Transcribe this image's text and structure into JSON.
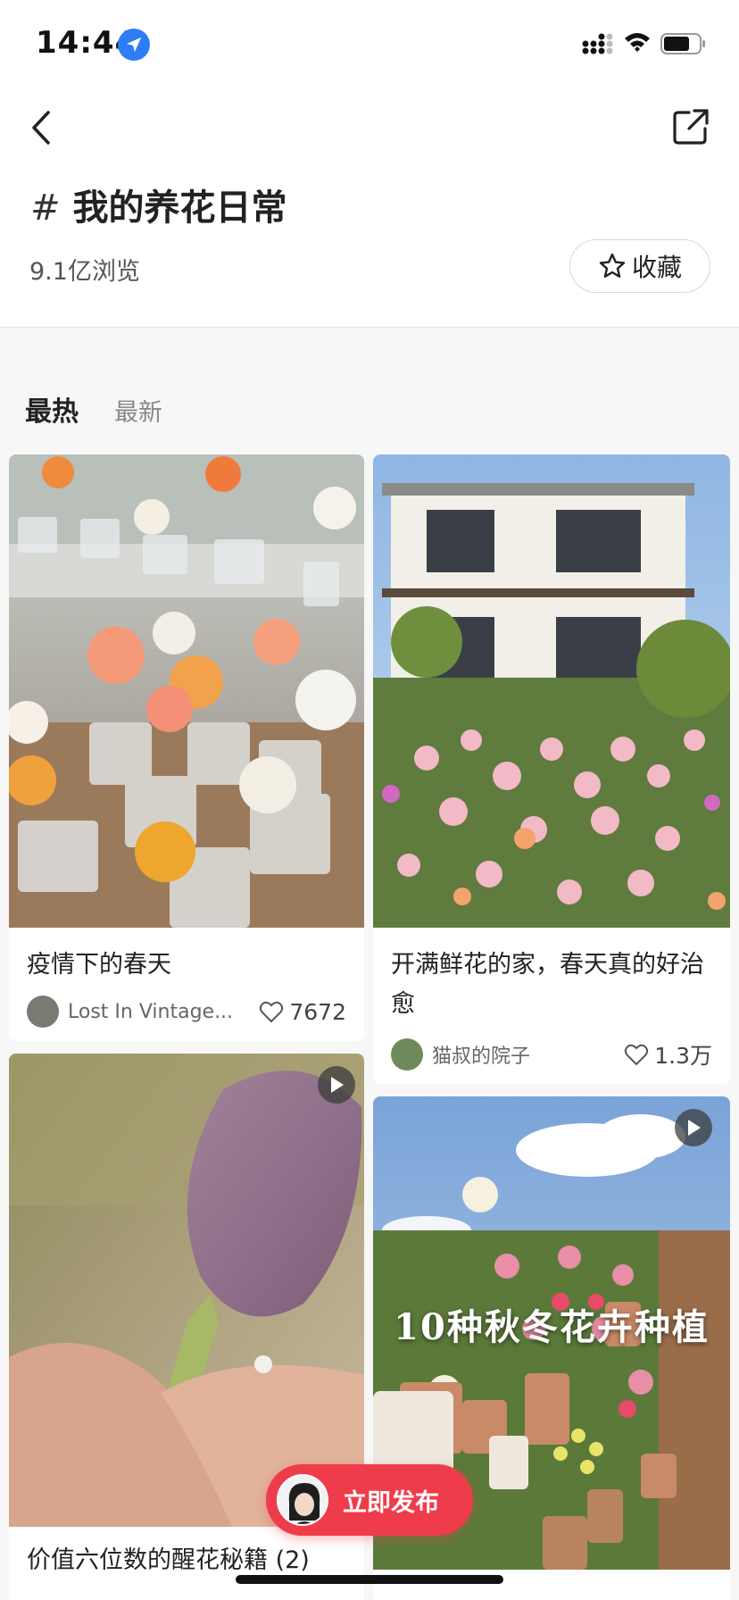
{
  "status_bar": {
    "time": "14:44"
  },
  "header": {
    "hash": "#",
    "title": "我的养花日常",
    "views": "9.1亿浏览",
    "favorite_label": "收藏"
  },
  "tabs": [
    {
      "label": "最热",
      "active": true
    },
    {
      "label": "最新",
      "active": false
    }
  ],
  "posts": [
    {
      "title": "疫情下的春天",
      "author": "Lost In Vintage...",
      "likes": "7672",
      "video": false
    },
    {
      "title": "开满鲜花的家，春天真的好治愈",
      "author": "猫叔的院子",
      "likes": "1.3万",
      "video": false
    },
    {
      "title": "价值六位数的醒花秘籍 (2)",
      "author": "",
      "likes": "",
      "video": true
    },
    {
      "title": "",
      "author": "",
      "likes": "",
      "video": true,
      "overlay_text": "10种秋冬花卉种植"
    }
  ],
  "publish_button": {
    "label": "立即发布"
  },
  "colors": {
    "accent": "#ef3c4a",
    "location": "#2f7df6"
  }
}
